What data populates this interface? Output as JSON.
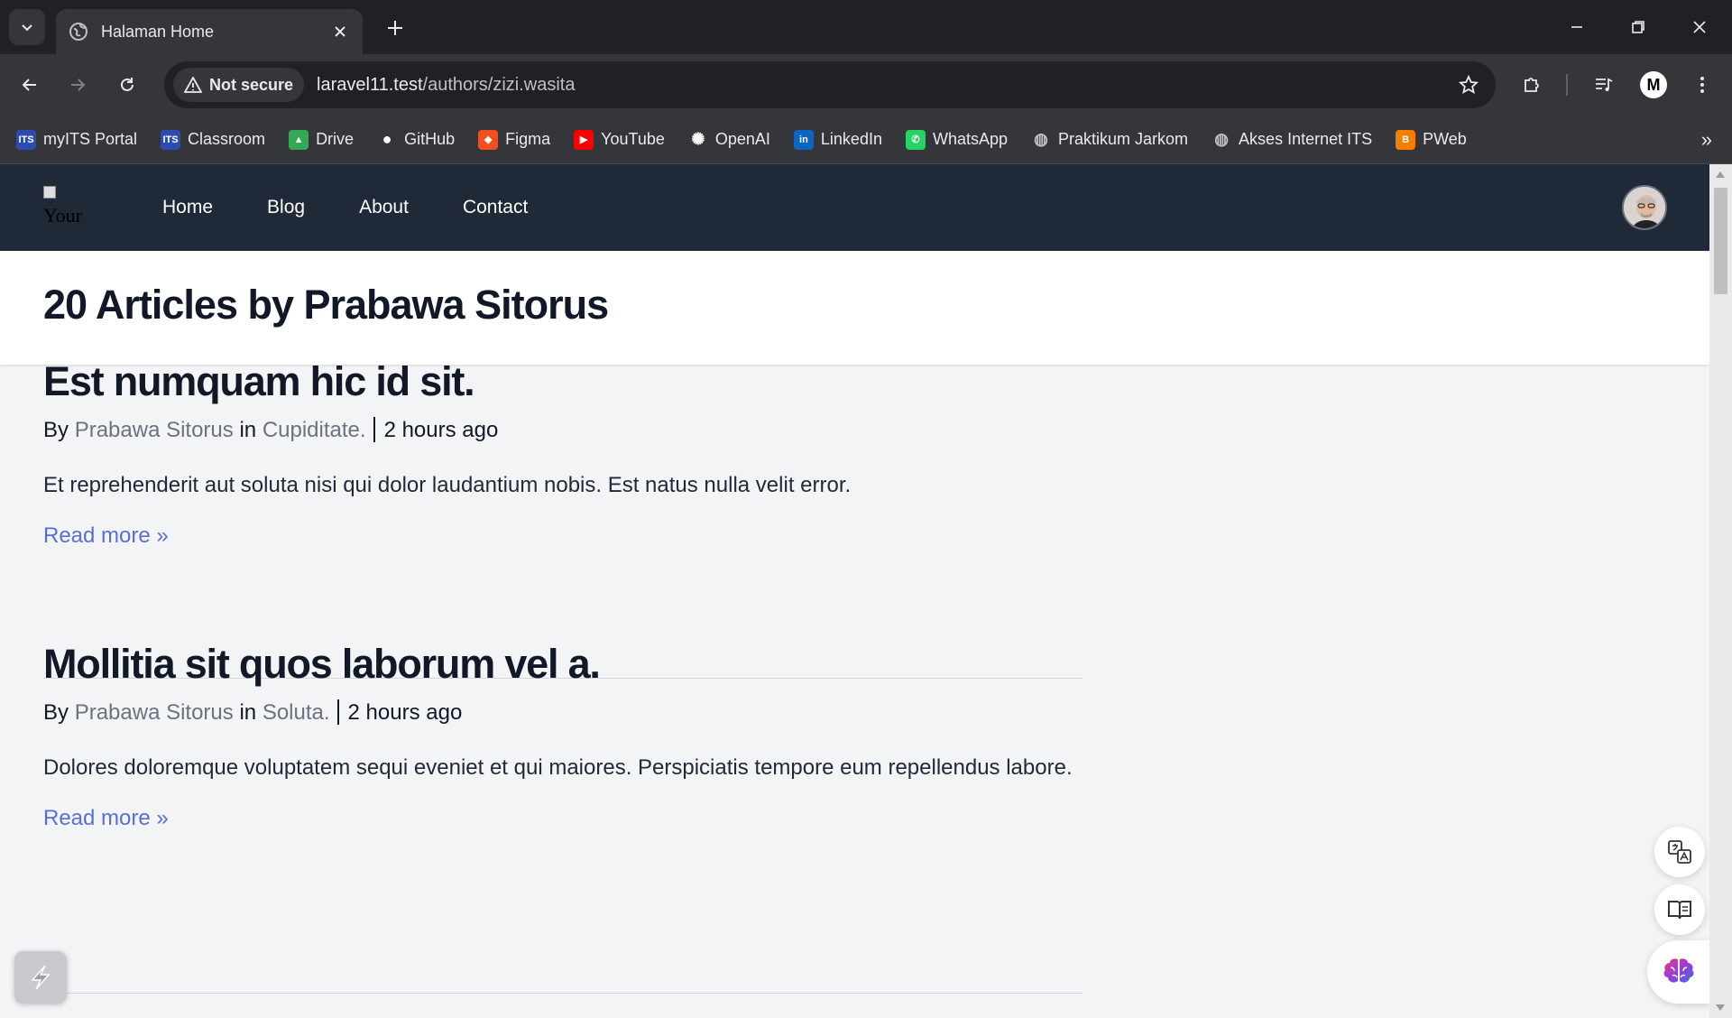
{
  "browser": {
    "tab_title": "Halaman Home",
    "security_label": "Not secure",
    "url_host": "laravel11.test",
    "url_path": "/authors/zizi.wasita",
    "profile_initial": "M",
    "bookmarks": [
      {
        "label": "myITS Portal",
        "icon": "its-icon",
        "color": "#2b4db0"
      },
      {
        "label": "Classroom",
        "icon": "its-icon",
        "color": "#2b4db0"
      },
      {
        "label": "Drive",
        "icon": "drive-icon",
        "color": "#34a853"
      },
      {
        "label": "GitHub",
        "icon": "github-icon",
        "color": "#ffffff"
      },
      {
        "label": "Figma",
        "icon": "figma-icon",
        "color": "#f24e1e"
      },
      {
        "label": "YouTube",
        "icon": "youtube-icon",
        "color": "#ff0000"
      },
      {
        "label": "OpenAI",
        "icon": "openai-icon",
        "color": "#ffffff"
      },
      {
        "label": "LinkedIn",
        "icon": "linkedin-icon",
        "color": "#0a66c2"
      },
      {
        "label": "WhatsApp",
        "icon": "whatsapp-icon",
        "color": "#25d366"
      },
      {
        "label": "Praktikum Jarkom",
        "icon": "globe-icon",
        "color": "#bdc1c6"
      },
      {
        "label": "Akses Internet ITS",
        "icon": "globe-icon",
        "color": "#bdc1c6"
      },
      {
        "label": "PWeb",
        "icon": "blogger-icon",
        "color": "#f57d00"
      }
    ]
  },
  "site": {
    "logo_alt": "Your",
    "nav": [
      "Home",
      "Blog",
      "About",
      "Contact"
    ]
  },
  "header": {
    "title": "20 Articles by Prabawa Sitorus"
  },
  "articles": [
    {
      "title": "Est numquam hic id sit.",
      "by": "By",
      "author": "Prabawa Sitorus",
      "in": "in",
      "category": "Cupiditate.",
      "time": "2 hours ago",
      "excerpt": "Et reprehenderit aut soluta nisi qui dolor laudantium nobis. Est natus nulla velit error.",
      "read_more": "Read more »"
    },
    {
      "title": "Mollitia sit quos laborum vel a.",
      "by": "By",
      "author": "Prabawa Sitorus",
      "in": "in",
      "category": "Soluta.",
      "time": "2 hours ago",
      "excerpt": "Dolores doloremque voluptatem sequi eveniet et qui maiores. Perspiciatis tempore eum repellendus labore.",
      "read_more": "Read more »"
    }
  ],
  "colors": {
    "nav_bg": "#1f2937",
    "link": "#5a6fd6",
    "meta_link": "#6b7280"
  }
}
